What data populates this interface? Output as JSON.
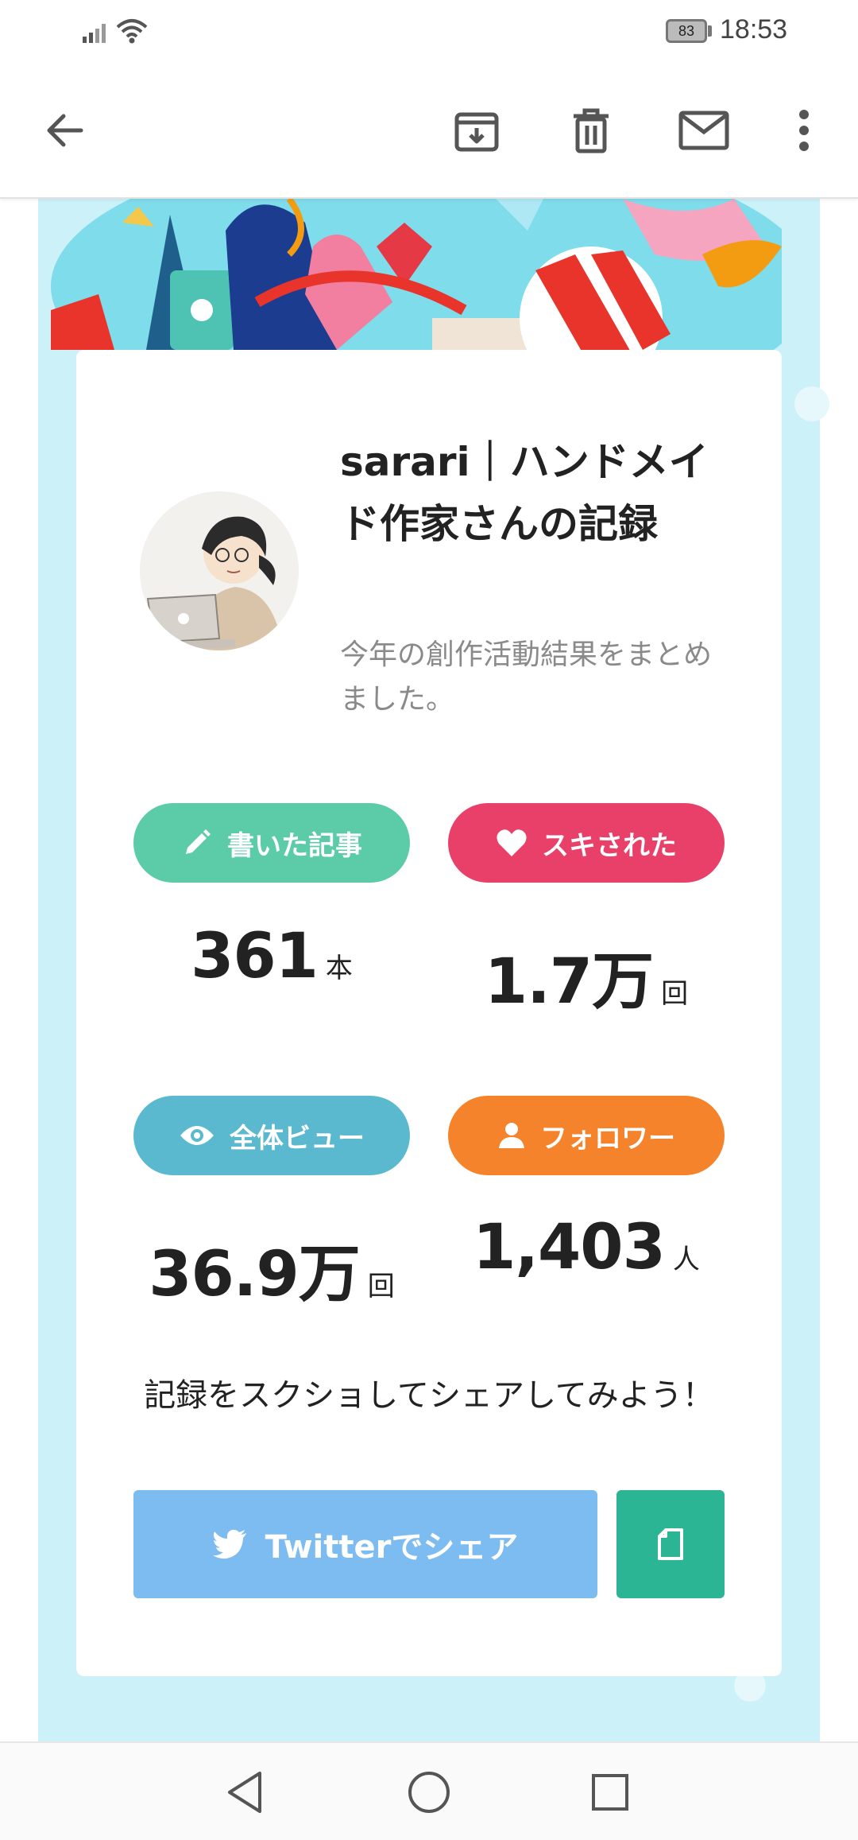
{
  "status_bar": {
    "time": "18:53",
    "battery": "83",
    "icons": [
      "signal-icon",
      "wifi-icon",
      "battery-icon"
    ]
  },
  "app_bar": {
    "icons": [
      "back-arrow-icon",
      "archive-icon",
      "delete-icon",
      "mail-icon",
      "more-vert-icon"
    ]
  },
  "profile": {
    "title": "sarari｜ハンドメイド作家さんの記録",
    "subtitle": "今年の創作活動結果をまとめました。"
  },
  "stats": [
    {
      "label": "書いた記事",
      "icon": "pencil-icon",
      "color": "#5ccba8",
      "value": "361",
      "unit": "本"
    },
    {
      "label": "スキされた",
      "icon": "heart-icon",
      "color": "#e9406a",
      "value": "1.7万",
      "unit": "回"
    },
    {
      "label": "全体ビュー",
      "icon": "eye-icon",
      "color": "#5bb9cf",
      "value": "36.9万",
      "unit": "回"
    },
    {
      "label": "フォロワー",
      "icon": "person-icon",
      "color": "#f5832b",
      "value": "1,403",
      "unit": "人"
    }
  ],
  "share": {
    "prompt": "記録をスクショしてシェアしてみよう！",
    "twitter_label": "Twitterでシェア",
    "twitter_color": "#7dbcf0",
    "copy_color": "#2bb594"
  },
  "nav_bar": {
    "icons": [
      "back-triangle-icon",
      "home-circle-icon",
      "recents-square-icon"
    ]
  }
}
